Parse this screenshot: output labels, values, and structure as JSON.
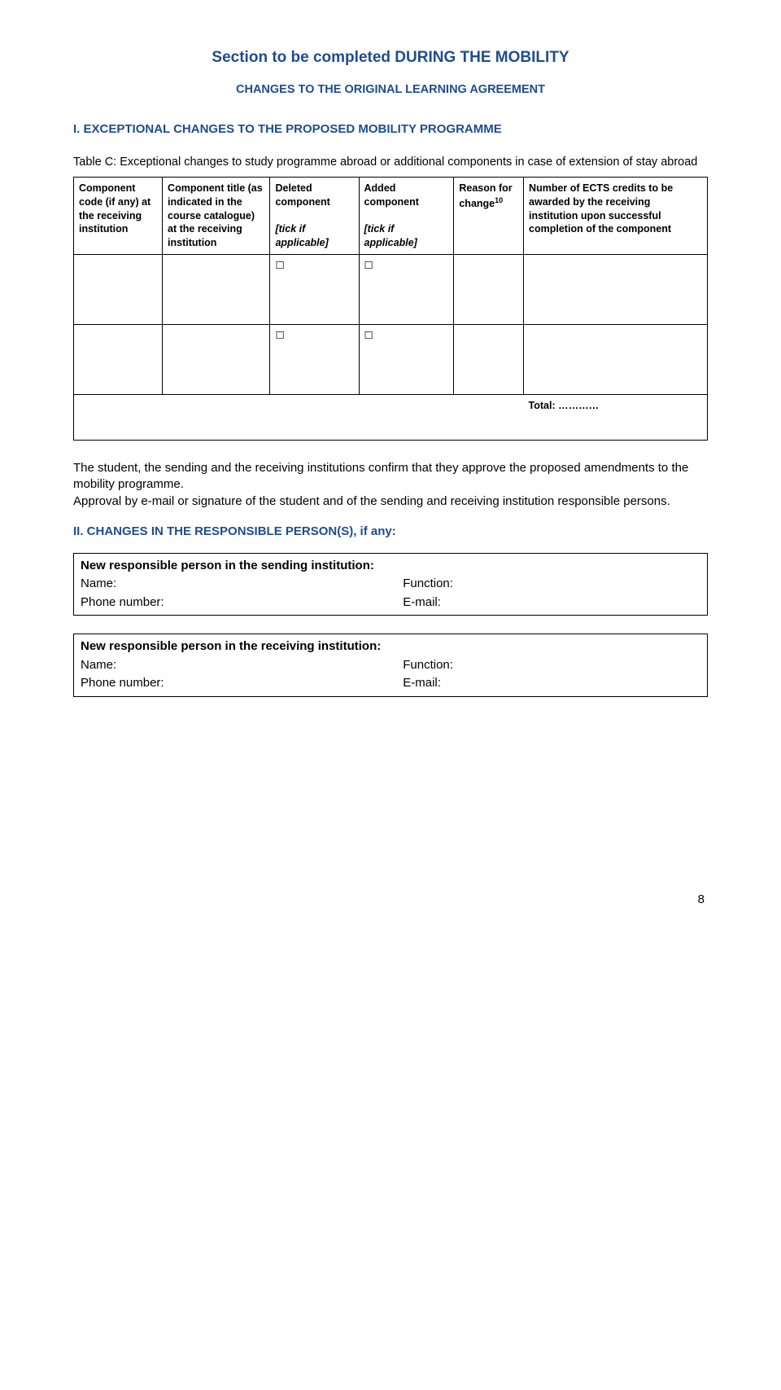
{
  "title": "Section to be completed DURING THE MOBILITY",
  "subtitle": "CHANGES TO THE ORIGINAL LEARNING AGREEMENT",
  "section1": {
    "prefix": "I.   ",
    "heading": "EXCEPTIONAL CHANGES TO THE PROPOSED MOBILITY PROGRAMME",
    "caption": "Table C: Exceptional changes to study programme abroad or additional components in case of extension of stay abroad"
  },
  "tableC": {
    "headers": {
      "code": "Component code (if any) at the receiving institution",
      "titlecol": "Component title (as indicated in the course catalogue) at the receiving institution",
      "deleted_a": "Deleted component",
      "deleted_b": "[tick if applicable]",
      "added_a": "Added component",
      "added_b": "[tick if applicable]",
      "reason_a": "Reason for change",
      "reason_sup": "10",
      "ects": "Number of ECTS credits to be awarded by the receiving institution upon successful completion of the component"
    },
    "boxglyph": "☐",
    "totalLabel": "Total: …………"
  },
  "para1": "The student, the sending and the receiving institutions confirm that they approve the proposed amendments to the mobility programme.",
  "para2": "Approval by e-mail or signature of the student and of the sending and receiving institution responsible persons.",
  "section2": {
    "heading": "II. CHANGES IN THE RESPONSIBLE PERSON(S), if any:"
  },
  "contactSending": {
    "title": "New responsible person in the sending institution:",
    "name": "Name:",
    "function": "Function:",
    "phone": "Phone number:",
    "email": "E-mail:"
  },
  "contactReceiving": {
    "title": "New responsible person in the receiving institution:",
    "name": "Name:",
    "function": "Function:",
    "phone": "Phone number:",
    "email": "E-mail:"
  },
  "pageNumber": "8"
}
